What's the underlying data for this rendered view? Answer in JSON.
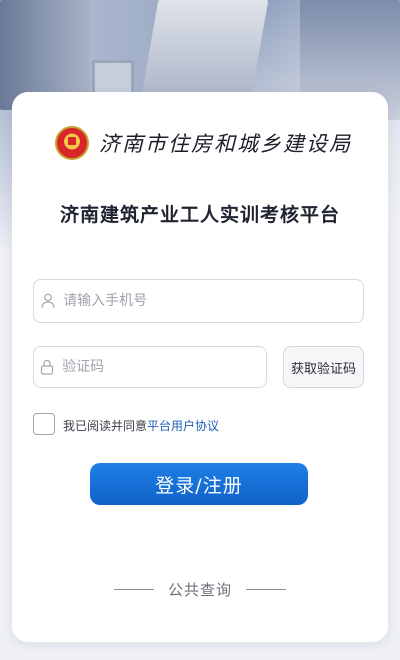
{
  "header": {
    "agency_name": "济南市住房和城乡建设局",
    "emblem_icon": "national-emblem-icon"
  },
  "title": "济南建筑产业工人实训考核平台",
  "form": {
    "phone": {
      "placeholder": "请输入手机号",
      "value": "",
      "icon": "user-icon"
    },
    "code": {
      "placeholder": "验证码",
      "value": "",
      "icon": "lock-icon"
    },
    "get_code_label": "获取验证码",
    "agree_prefix": "我已阅读并同意",
    "agree_link": "平台用户协议",
    "agree_checked": false,
    "login_label": "登录/注册"
  },
  "footer": {
    "public_query_label": "公共查询"
  },
  "colors": {
    "primary": "#0f62c8",
    "link": "#1f5fb8"
  }
}
